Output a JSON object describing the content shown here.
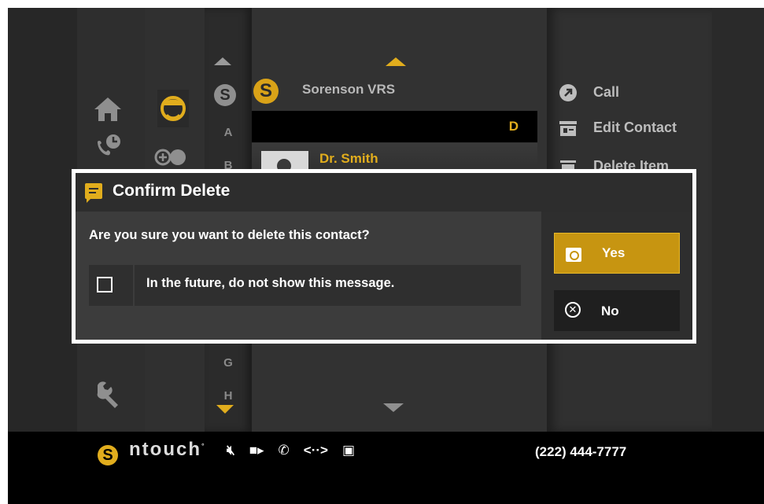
{
  "contacts": {
    "top_contact": "Sorenson VRS",
    "section_letter": "D",
    "visible_contact": "Dr. Smith",
    "alpha_index": [
      "A",
      "B",
      "G",
      "H"
    ]
  },
  "actions": {
    "call": "Call",
    "edit_contact": "Edit Contact",
    "delete_item": "Delete Item"
  },
  "dialog": {
    "title": "Confirm Delete",
    "question": "Are you sure you want to delete this contact?",
    "checkbox_label": "In the future, do not show this message.",
    "yes_label": "Yes",
    "no_label": "No"
  },
  "status_bar": {
    "brand": "ntouch",
    "phone_number": "(222) 444-7777",
    "icons": [
      "mic-muted-icon",
      "video-camera-icon",
      "phone-icon",
      "signal-icon",
      "monitor-icon"
    ]
  },
  "colors": {
    "accent": "#e1ad1d",
    "background": "#272727",
    "dialog_border": "#ffffff"
  }
}
